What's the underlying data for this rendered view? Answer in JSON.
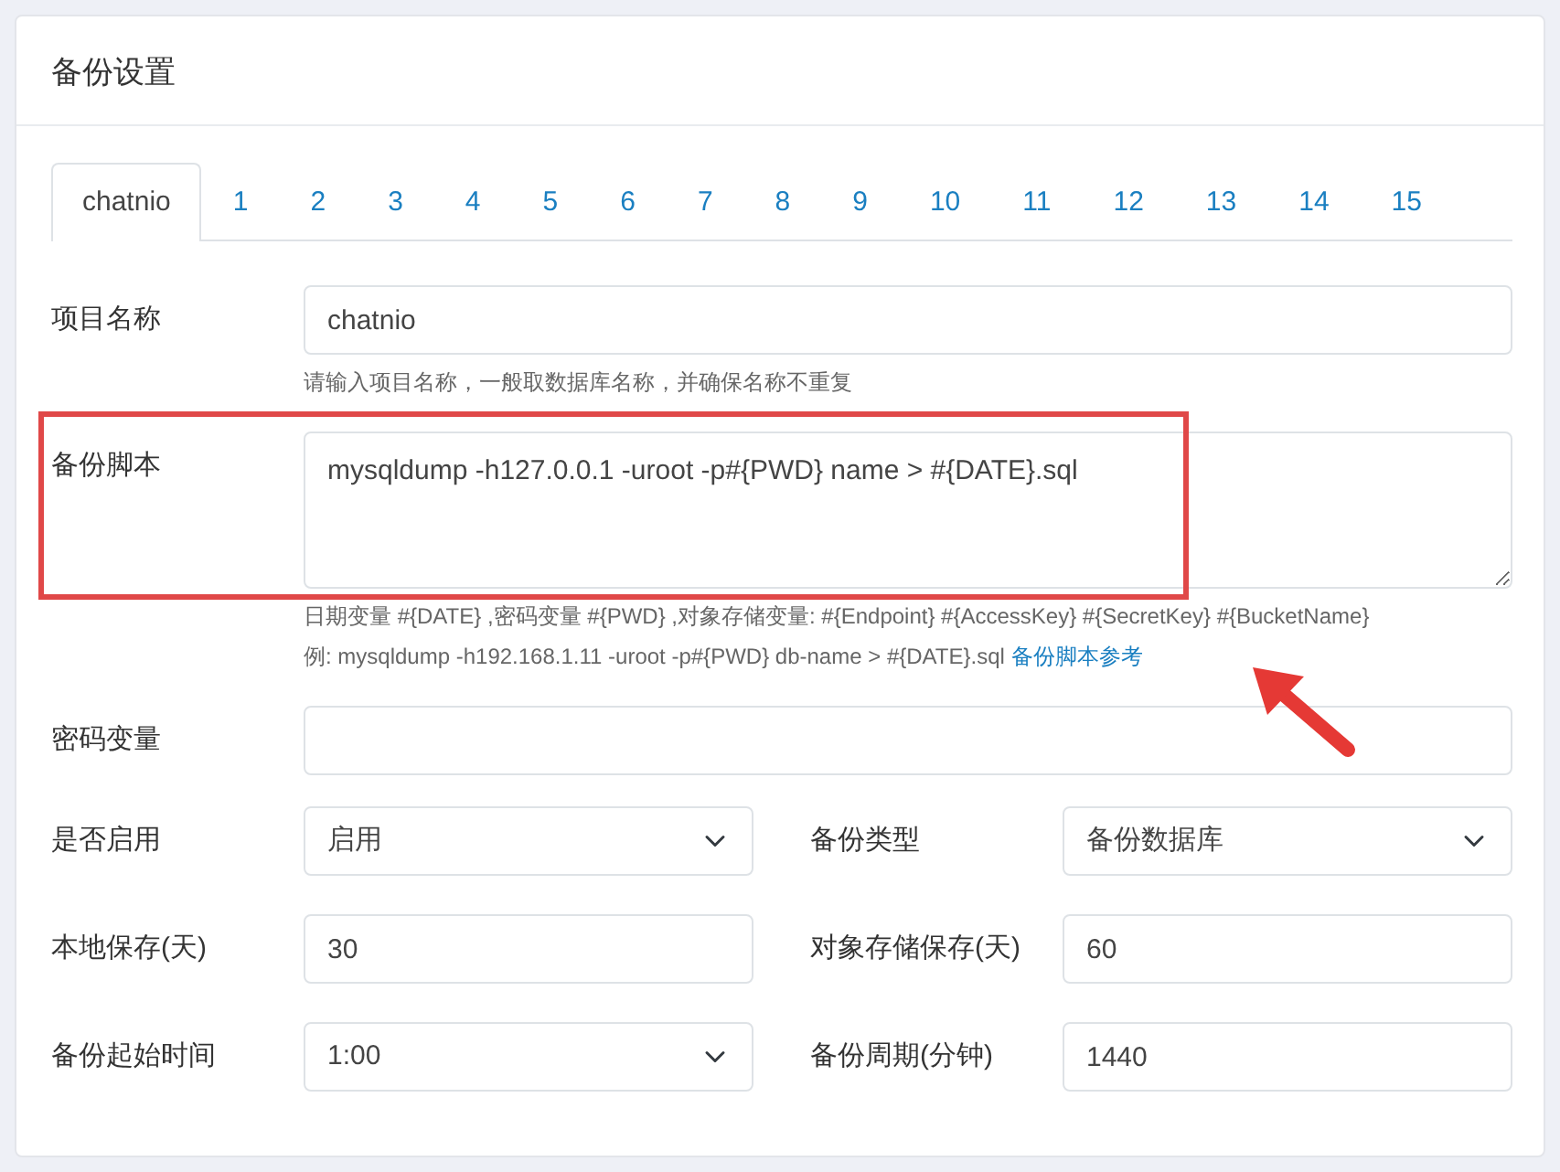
{
  "title": "备份设置",
  "tabs": [
    {
      "label": "chatnio",
      "selected": true
    },
    {
      "label": "1",
      "selected": false
    },
    {
      "label": "2",
      "selected": false
    },
    {
      "label": "3",
      "selected": false
    },
    {
      "label": "4",
      "selected": false
    },
    {
      "label": "5",
      "selected": false
    },
    {
      "label": "6",
      "selected": false
    },
    {
      "label": "7",
      "selected": false
    },
    {
      "label": "8",
      "selected": false
    },
    {
      "label": "9",
      "selected": false
    },
    {
      "label": "10",
      "selected": false
    },
    {
      "label": "11",
      "selected": false
    },
    {
      "label": "12",
      "selected": false
    },
    {
      "label": "13",
      "selected": false
    },
    {
      "label": "14",
      "selected": false
    },
    {
      "label": "15",
      "selected": false
    }
  ],
  "rows": [
    [
      {
        "kind": "text",
        "label": "项目名称",
        "value": "chatnio",
        "hints": [
          {
            "text": "请输入项目名称，一般取数据库名称，并确保名称不重复"
          }
        ]
      }
    ],
    [
      {
        "kind": "textarea",
        "label": "备份脚本",
        "value": "mysqldump -h127.0.0.1 -uroot -p#{PWD} name > #{DATE}.sql",
        "highlighted": true,
        "hints": [
          {
            "text": "日期变量 #{DATE} ,密码变量 #{PWD} ,对象存储变量: #{Endpoint} #{AccessKey} #{SecretKey} #{BucketName}"
          },
          {
            "text": "例: mysqldump -h192.168.1.11 -uroot -p#{PWD} db-name > #{DATE}.sql",
            "link": "备份脚本参考"
          }
        ]
      }
    ],
    [
      {
        "kind": "text",
        "label": "密码变量"
      }
    ],
    [
      {
        "kind": "select",
        "label": "是否启用",
        "value": "启用"
      },
      {
        "kind": "select",
        "label": "备份类型",
        "value": "备份数据库"
      }
    ],
    [
      {
        "kind": "text",
        "label": "本地保存(天)",
        "value": "30"
      },
      {
        "kind": "text",
        "label": "对象存储保存(天)",
        "value": "60"
      }
    ],
    [
      {
        "kind": "select",
        "label": "备份起始时间",
        "value": "1:00"
      },
      {
        "kind": "text",
        "label": "备份周期(分钟)",
        "value": "1440"
      }
    ]
  ]
}
